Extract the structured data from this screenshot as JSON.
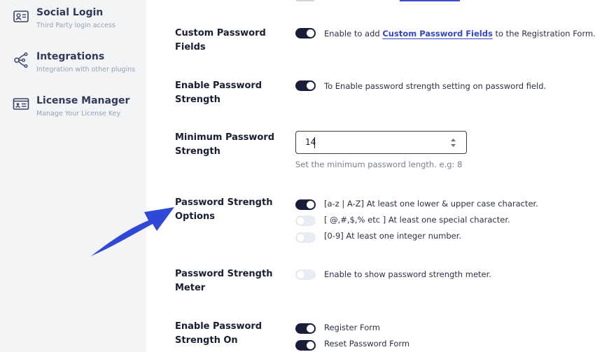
{
  "sidebar": {
    "items": [
      {
        "title": "Social Login",
        "subtitle": "Third Party login access",
        "icon": "contact-card-icon"
      },
      {
        "title": "Integrations",
        "subtitle": "Integration with other plugins",
        "icon": "integrations-icon"
      },
      {
        "title": "License Manager",
        "subtitle": "Manage Your License Key",
        "icon": "id-card-icon"
      }
    ]
  },
  "settings": {
    "custom_fields": {
      "label": "Custom Password Fields",
      "desc_prefix": "Enable to add ",
      "desc_link": "Custom Password Fields",
      "desc_suffix": " to the Registration Form.",
      "enabled": true
    },
    "enable_strength": {
      "label": "Enable Password Strength",
      "desc": "To Enable password strength setting on password field.",
      "enabled": true
    },
    "min_length": {
      "label": "Minimum Password Strength",
      "value": "14",
      "hint": "Set the minimum password length. e.g: 8"
    },
    "strength_options": {
      "label": "Password Strength Options",
      "options": [
        {
          "text": "[a-z | A-Z] At least one lower & upper case character.",
          "enabled": true
        },
        {
          "text": "[ @,#,$,% etc ] At least one special character.",
          "enabled": false
        },
        {
          "text": "[0-9] At least one integer number.",
          "enabled": false
        }
      ]
    },
    "strength_meter": {
      "label": "Password Strength Meter",
      "desc": "Enable to show password strength meter.",
      "enabled": false
    },
    "strength_on": {
      "label": "Enable Password Strength On",
      "options": [
        {
          "text": "Register Form",
          "enabled": true
        },
        {
          "text": "Reset Password Form",
          "enabled": true
        }
      ]
    }
  },
  "colors": {
    "toggle_on": "#1b1d38",
    "toggle_off": "#e8ecf5",
    "link": "#3344c4",
    "arrow": "#2f49d6"
  }
}
